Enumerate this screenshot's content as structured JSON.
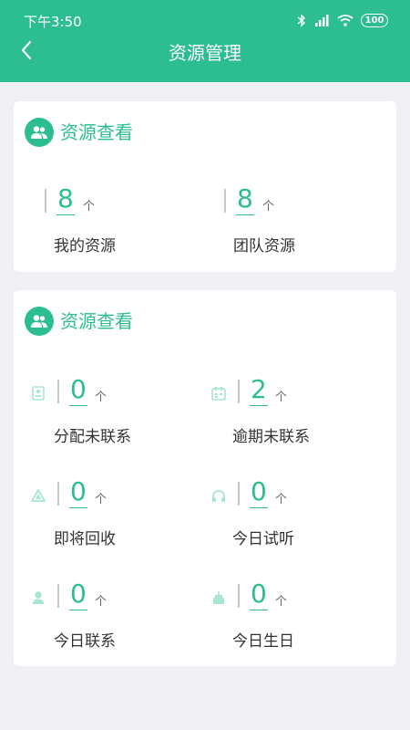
{
  "status_bar": {
    "time": "下午3:50",
    "battery": "100",
    "icons": [
      "bluetooth-icon",
      "signal-icon",
      "wifi-icon",
      "battery-icon"
    ]
  },
  "header": {
    "title": "资源管理",
    "back_icon": "chevron-left-icon",
    "background": "#2cbd91"
  },
  "colors": {
    "accent": "#2cbd91",
    "page_bg": "#f0f0f4",
    "text": "#333333"
  },
  "card1": {
    "title": "资源查看",
    "icon": "people-icon",
    "stats": [
      {
        "value": "8",
        "unit": "个",
        "label": "我的资源"
      },
      {
        "value": "8",
        "unit": "个",
        "label": "团队资源"
      }
    ]
  },
  "card2": {
    "title": "资源查看",
    "icon": "people-icon",
    "stats": [
      {
        "value": "0",
        "unit": "个",
        "label": "分配未联系",
        "icon": "contact-card-icon"
      },
      {
        "value": "2",
        "unit": "个",
        "label": "逾期未联系",
        "icon": "calendar-icon"
      },
      {
        "value": "0",
        "unit": "个",
        "label": "即将回收",
        "icon": "recycle-icon"
      },
      {
        "value": "0",
        "unit": "个",
        "label": "今日试听",
        "icon": "headphones-icon"
      },
      {
        "value": "0",
        "unit": "个",
        "label": "今日联系",
        "icon": "person-icon"
      },
      {
        "value": "0",
        "unit": "个",
        "label": "今日生日",
        "icon": "cake-icon"
      }
    ]
  }
}
